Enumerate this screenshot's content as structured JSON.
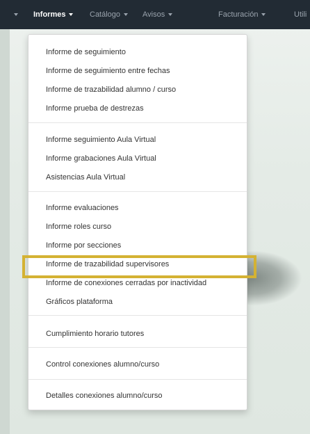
{
  "navbar": {
    "items": [
      {
        "label": "Informes",
        "active": true,
        "has_caret": true
      },
      {
        "label": "Catálogo",
        "active": false,
        "has_caret": true
      },
      {
        "label": "Avisos",
        "active": false,
        "has_caret": true
      },
      {
        "label": "Facturación",
        "active": false,
        "has_caret": true
      },
      {
        "label": "Utili",
        "active": false,
        "has_caret": false
      }
    ]
  },
  "menu": {
    "groups": [
      [
        "Informe de seguimiento",
        "Informe de seguimiento entre fechas",
        "Informe de trazabilidad alumno / curso",
        "Informe prueba de destrezas"
      ],
      [
        "Informe seguimiento Aula Virtual",
        "Informe grabaciones Aula Virtual",
        "Asistencias Aula Virtual"
      ],
      [
        "Informe evaluaciones",
        "Informe roles curso",
        "Informe por secciones",
        "Informe de trazabilidad supervisores",
        "Informe de conexiones cerradas por inactividad",
        "Gráficos plataforma"
      ],
      [
        "Cumplimiento horario tutores"
      ],
      [
        "Control conexiones alumno/curso"
      ],
      [
        "Detalles conexiones alumno/curso"
      ]
    ],
    "highlighted_item": "Informe de trazabilidad supervisores"
  },
  "colors": {
    "navbar_bg": "#222b34",
    "highlight": "#d4b233"
  }
}
